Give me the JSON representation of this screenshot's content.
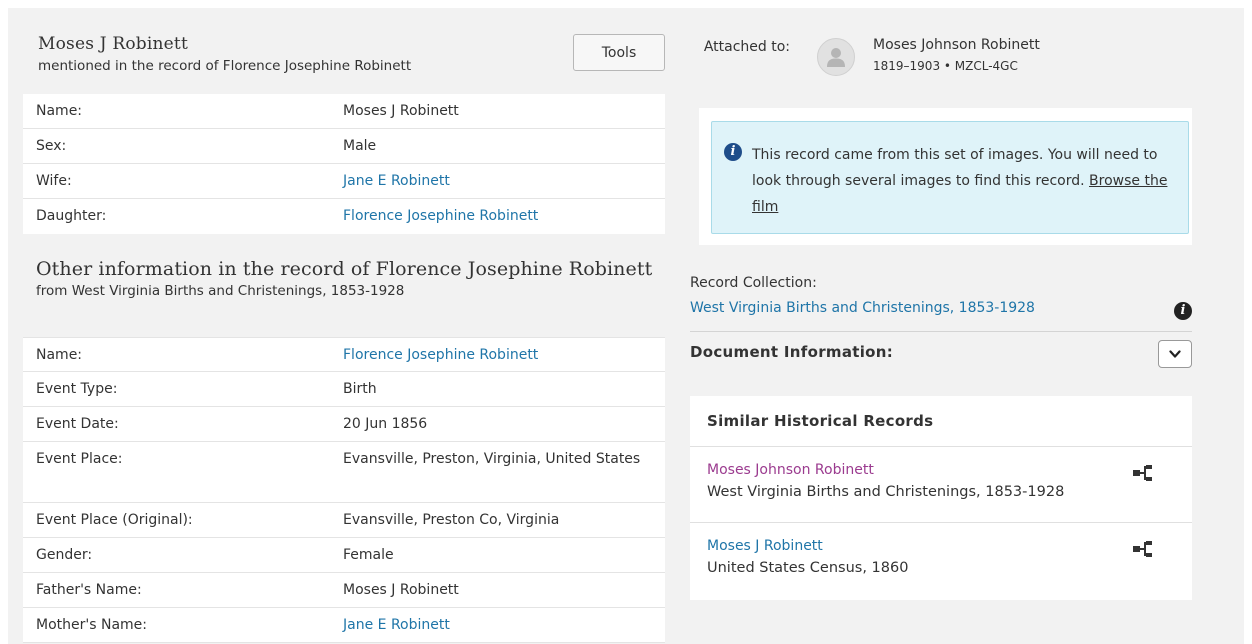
{
  "person": {
    "name": "Moses J Robinett",
    "subtitle": "mentioned in the record of Florence Josephine Robinett",
    "tools_label": "Tools",
    "rows": [
      {
        "label": "Name:",
        "value": "Moses J Robinett",
        "link": false
      },
      {
        "label": "Sex:",
        "value": "Male",
        "link": false
      },
      {
        "label": "Wife:",
        "value": "Jane E Robinett",
        "link": true
      },
      {
        "label": "Daughter:",
        "value": "Florence Josephine Robinett",
        "link": true
      }
    ]
  },
  "other": {
    "title": "Other information in the record of Florence Josephine Robinett",
    "subtitle": "from West Virginia Births and Christenings, 1853-1928",
    "rows": [
      {
        "label": "Name:",
        "value": "Florence Josephine Robinett",
        "link": true
      },
      {
        "label": "Event Type:",
        "value": "Birth",
        "link": false
      },
      {
        "label": "Event Date:",
        "value": "20 Jun 1856",
        "link": false
      },
      {
        "label": "Event Place:",
        "value": "Evansville, Preston, Virginia, United States",
        "link": false
      },
      {
        "label": "Event Place (Original):",
        "value": "Evansville, Preston Co, Virginia",
        "link": false
      },
      {
        "label": "Gender:",
        "value": "Female",
        "link": false
      },
      {
        "label": "Father's Name:",
        "value": "Moses J Robinett",
        "link": false
      },
      {
        "label": "Mother's Name:",
        "value": "Jane E Robinett",
        "link": true
      }
    ]
  },
  "attached": {
    "label": "Attached to:",
    "name": "Moses Johnson Robinett",
    "meta": "1819–1903 • MZCL-4GC",
    "avatar_icon": "person-silhouette-icon"
  },
  "notice": {
    "icon": "info-icon",
    "text_before": "This record came from this set of images. You will need to look through several images to find this record.",
    "browse_link": "Browse the film",
    "bg_color": "#dff3f9"
  },
  "collection": {
    "label": "Record Collection:",
    "link": "West Virginia Births and Christenings, 1853-1928"
  },
  "document": {
    "label": "Document Information:",
    "toggle_icon": "chevron-down-icon"
  },
  "similar": {
    "title": "Similar Historical Records",
    "items": [
      {
        "name": "Moses Johnson Robinett",
        "collection": "West Virginia Births and Christenings, 1853-1928",
        "visited": true
      },
      {
        "name": "Moses J Robinett",
        "collection": "United States Census, 1860",
        "visited": false
      }
    ]
  },
  "colors": {
    "link": "#1f75a8",
    "visited_link": "#9b3b8f",
    "page_bg": "#f2f2f2"
  }
}
